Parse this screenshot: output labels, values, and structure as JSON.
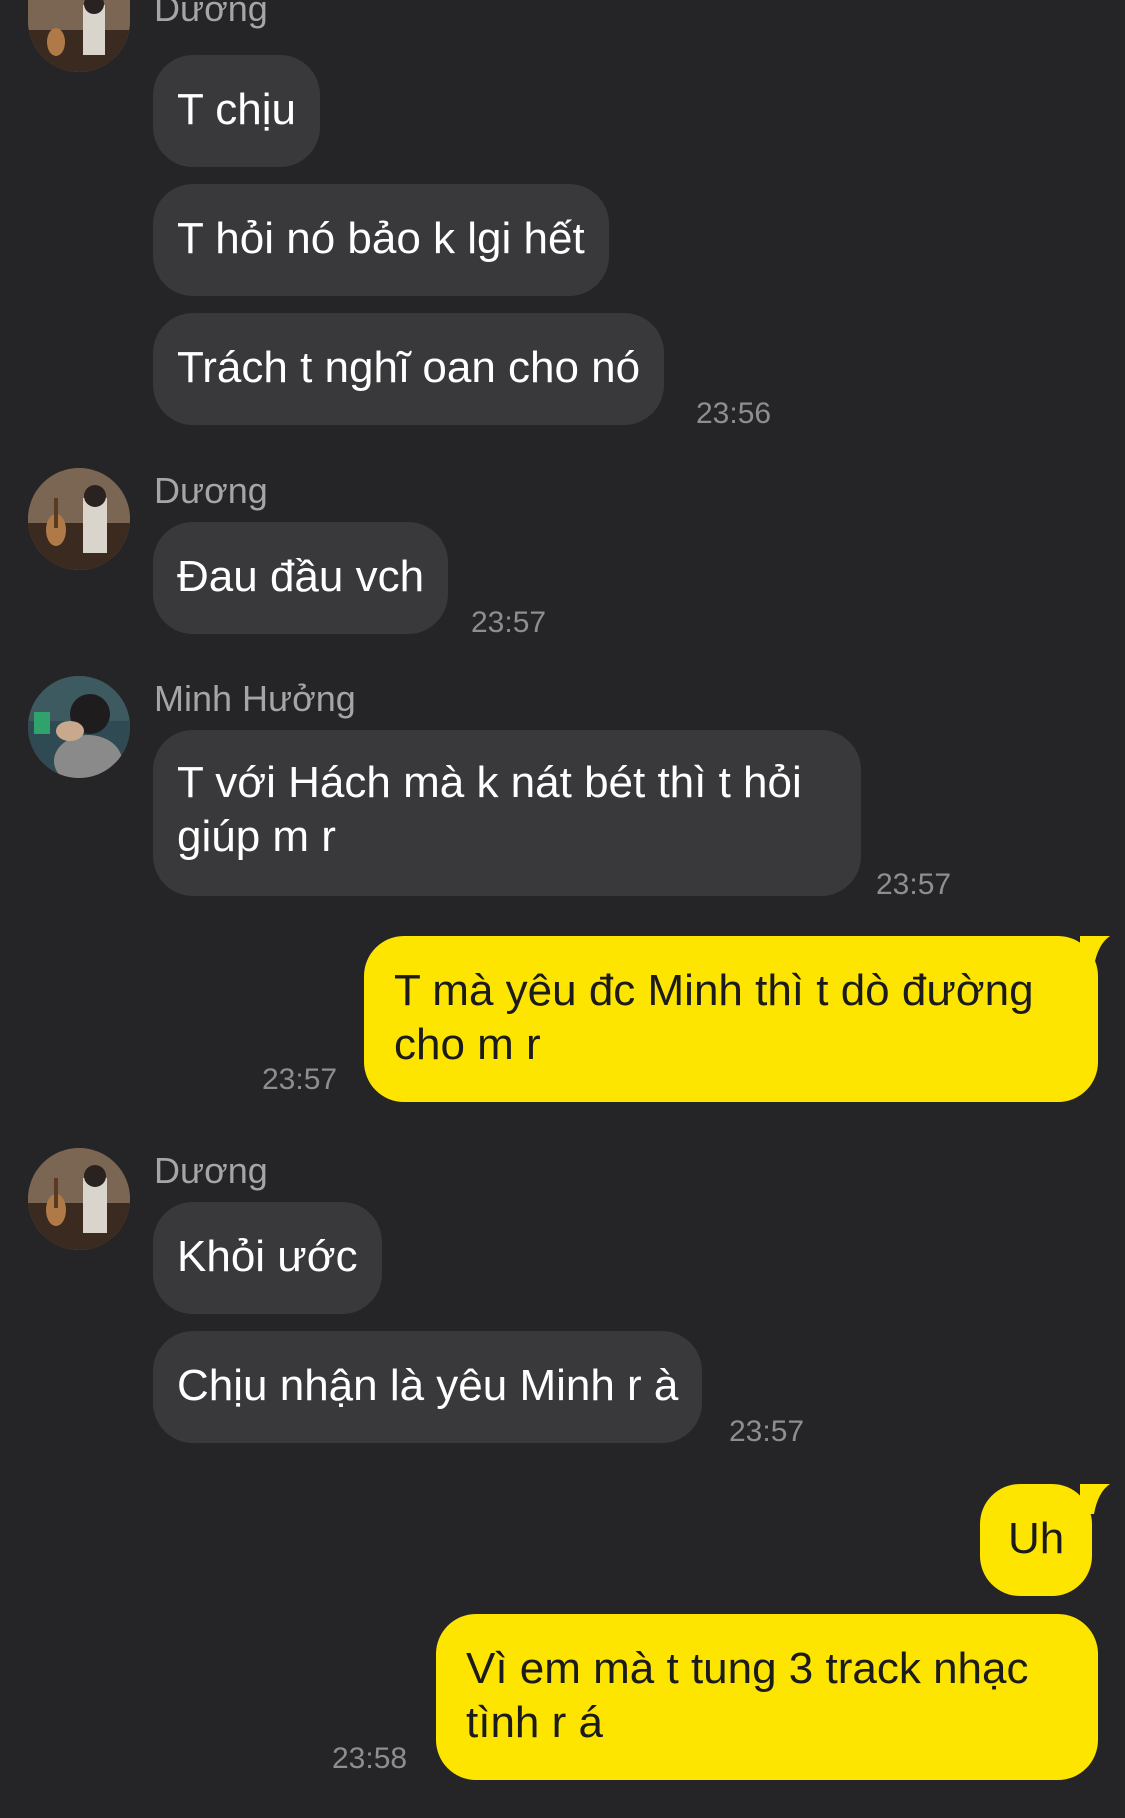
{
  "colors": {
    "background": "#252527",
    "incoming_bubble": "#39393c",
    "outgoing_bubble": "#fee500",
    "incoming_text": "#ffffff",
    "outgoing_text": "#1b1b1b",
    "timestamp": "#8e8e92"
  },
  "groups": [
    {
      "sender": "Dương",
      "avatar": "guitar-sofa-avatar",
      "messages": [
        "T chịu",
        "T hỏi nó bảo k lgi hết",
        "Trách t nghĩ oan cho nó"
      ],
      "time": "23:56"
    },
    {
      "sender": "Dương",
      "avatar": "guitar-sofa-avatar",
      "messages": [
        "Đau đầu vch"
      ],
      "time": "23:57"
    },
    {
      "sender": "Minh Hưởng",
      "avatar": "person-portrait-avatar",
      "messages": [
        "T với Hách mà k nát bét thì t hỏi giúp m r"
      ],
      "time": "23:57"
    },
    {
      "sender": "me",
      "messages": [
        "T mà yêu đc Minh thì t dò đường cho m r"
      ],
      "time": "23:57"
    },
    {
      "sender": "Dương",
      "avatar": "guitar-sofa-avatar",
      "messages": [
        "Khỏi ước",
        "Chịu nhận là yêu Minh r à"
      ],
      "time": "23:57"
    },
    {
      "sender": "me",
      "messages": [
        "Uh",
        "Vì em mà t tung 3 track nhạc tình r á"
      ],
      "time": "23:58"
    }
  ]
}
